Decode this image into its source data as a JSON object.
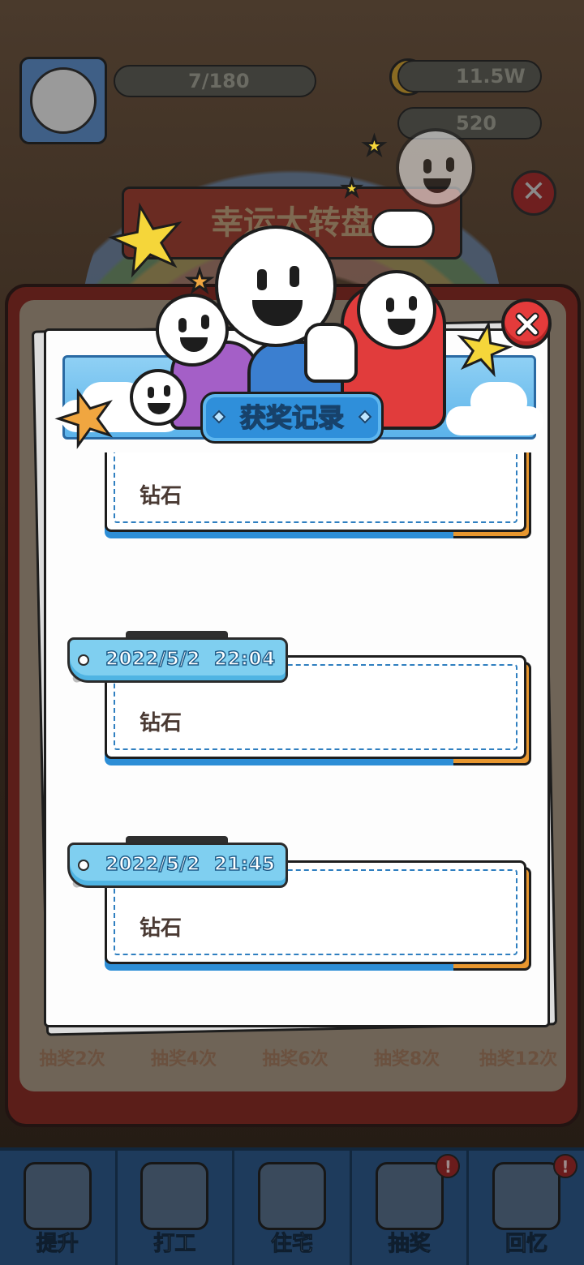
{
  "background": {
    "energy": "7/180",
    "coins": "11.5W",
    "gems": "520",
    "banner_title": "幸运大转盘",
    "progress_labels": [
      "抽奖2次",
      "抽奖4次",
      "抽奖6次",
      "抽奖8次",
      "抽奖12次"
    ],
    "nav": [
      {
        "label": "提升",
        "badge": ""
      },
      {
        "label": "打工",
        "badge": ""
      },
      {
        "label": "住宅",
        "badge": ""
      },
      {
        "label": "抽奖",
        "badge": "!"
      },
      {
        "label": "回忆",
        "badge": "!"
      }
    ]
  },
  "modal": {
    "title": "获奖记录",
    "records": [
      {
        "date": "",
        "prize": "钻石"
      },
      {
        "date": "2022/5/2  22:04",
        "prize": "钻石"
      },
      {
        "date": "2022/5/2  21:45",
        "prize": "钻石"
      }
    ]
  },
  "colors": {
    "accent_blue": "#2f8fda",
    "tag_blue": "#7fcff0",
    "close_red": "#e43b3b",
    "star_yellow": "#f5d63a"
  }
}
